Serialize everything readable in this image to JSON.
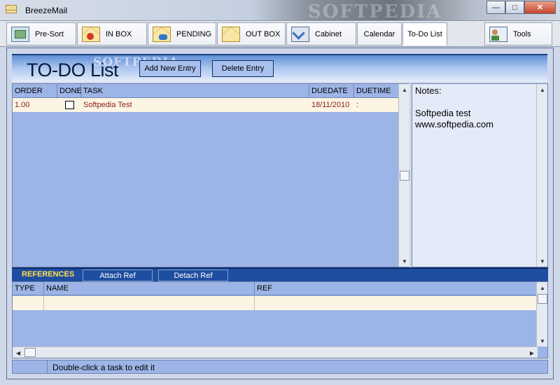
{
  "window": {
    "title": "BreezeMail",
    "watermark": "SOFTPEDIA",
    "minimize": "—",
    "maximize": "□",
    "close": "✕"
  },
  "toolbar": [
    {
      "label": "Pre-Sort",
      "icon": "presort-icon"
    },
    {
      "label": "IN BOX",
      "icon": "inbox-icon"
    },
    {
      "label": "PENDING",
      "icon": "pending-icon"
    },
    {
      "label": "OUT BOX",
      "icon": "outbox-icon"
    },
    {
      "label": "Cabinet",
      "icon": "cabinet-icon"
    },
    {
      "label": "Calendar"
    },
    {
      "label": "To-Do List"
    },
    {
      "label": "Tools",
      "icon": "tools-icon"
    }
  ],
  "header": {
    "title": "TO-DO List",
    "watermark": "SOFTPEDIA",
    "add_label": "Add New Entry",
    "delete_label": "Delete Entry"
  },
  "tasks": {
    "columns": [
      "ORDER",
      "DONE",
      "TASK",
      "DUEDATE",
      "DUETIME"
    ],
    "rows": [
      {
        "order": "1.00",
        "done": false,
        "task": "Softpedia Test",
        "duedate": "18/11/2010",
        "duetime": ":"
      }
    ]
  },
  "notes": {
    "label": "Notes:",
    "line1": "Softpedia test",
    "line2": "www.softpedia.com"
  },
  "references": {
    "label": "REFERENCES",
    "attach_label": "Attach Ref",
    "detach_label": "Detach Ref",
    "columns": [
      "TYPE",
      "NAME",
      "REF"
    ]
  },
  "status": {
    "message": "Double-click a task to edit it"
  },
  "colors": {
    "accent": "#1f4ea0",
    "grid": "#9db5e6",
    "row": "#fdf5e4",
    "task_text": "#8a1a1a",
    "ref_label": "#ffe04a"
  }
}
